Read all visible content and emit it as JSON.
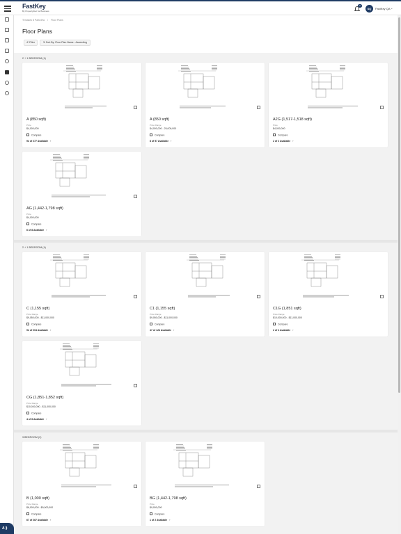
{
  "app": {
    "brand_name": "FastKey",
    "brand_tagline": "By Propertybloc for Business",
    "notifications_count": "9",
    "user": {
      "initials": "SQ",
      "name": "FastKey QA"
    },
    "accent_color": "#1f3b64"
  },
  "a11y": {
    "label": "A ⟫"
  },
  "breadcrumb": [
    "Temasek 8 Parkview",
    "/",
    "Floor Plans"
  ],
  "page": {
    "title": "Floor Plans",
    "filter_label": "Filter",
    "sort_label": "Sort By: Floor Plan Name - Ascending"
  },
  "sections": [
    {
      "label": "2 + 1 BEDROOM (4)",
      "cards": [
        {
          "name": "A (850 sqft)",
          "price_label": "Price",
          "price": "$4,000,000",
          "compare_label": "Compare",
          "availability": "94 of 277 Available"
        },
        {
          "name": "A (850 sqft)",
          "price_label": "Price Range",
          "price": "$4,000,000 - 25,000,000",
          "compare_label": "Compare",
          "availability": "8 of 57 Available"
        },
        {
          "name": "A2G (1,517-1,518 sqft)",
          "price_label": "Price",
          "price": "$4,000,000",
          "compare_label": "Compare",
          "availability": "2 of 2 Available"
        },
        {
          "name": "AG (1,442-1,798 sqft)",
          "price_label": "Price",
          "price": "$4,000,000",
          "compare_label": "Compare",
          "availability": "6 of 8 Available"
        }
      ]
    },
    {
      "label": "2 + 1 BEDROOM (4)",
      "cards": [
        {
          "name": "C (1,155 sqft)",
          "price_label": "Price Range",
          "price": "$9,050,000 - $11,000,000",
          "compare_label": "Compare",
          "availability": "94 of 204 Available"
        },
        {
          "name": "C1 (1,155 sqft)",
          "price_label": "Price Range",
          "price": "$9,050,000 - $11,000,000",
          "compare_label": "Compare",
          "availability": "47 of 124 Available"
        },
        {
          "name": "C1G (1,851 sqft)",
          "price_label": "Price Range",
          "price": "$10,000,000 - $11,000,000",
          "compare_label": "Compare",
          "availability": "2 of 4 Available"
        },
        {
          "name": "CG (1,851-1,852 sqft)",
          "price_label": "Price Range",
          "price": "$10,000,000 - $11,000,000",
          "compare_label": "Compare",
          "availability": "4 of 6 Available"
        }
      ]
    },
    {
      "label": "3 BEDROOM (2)",
      "cards": [
        {
          "name": "B (1,000 sqft)",
          "price_label": "Price Range",
          "price": "$6,000,000 - $9,000,000",
          "compare_label": "Compare",
          "availability": "67 of 267 Available"
        },
        {
          "name": "BG (1,442-1,798 sqft)",
          "price_label": "Price",
          "price": "$9,000,000",
          "compare_label": "Compare",
          "availability": "1 of 2 Available"
        }
      ]
    }
  ]
}
